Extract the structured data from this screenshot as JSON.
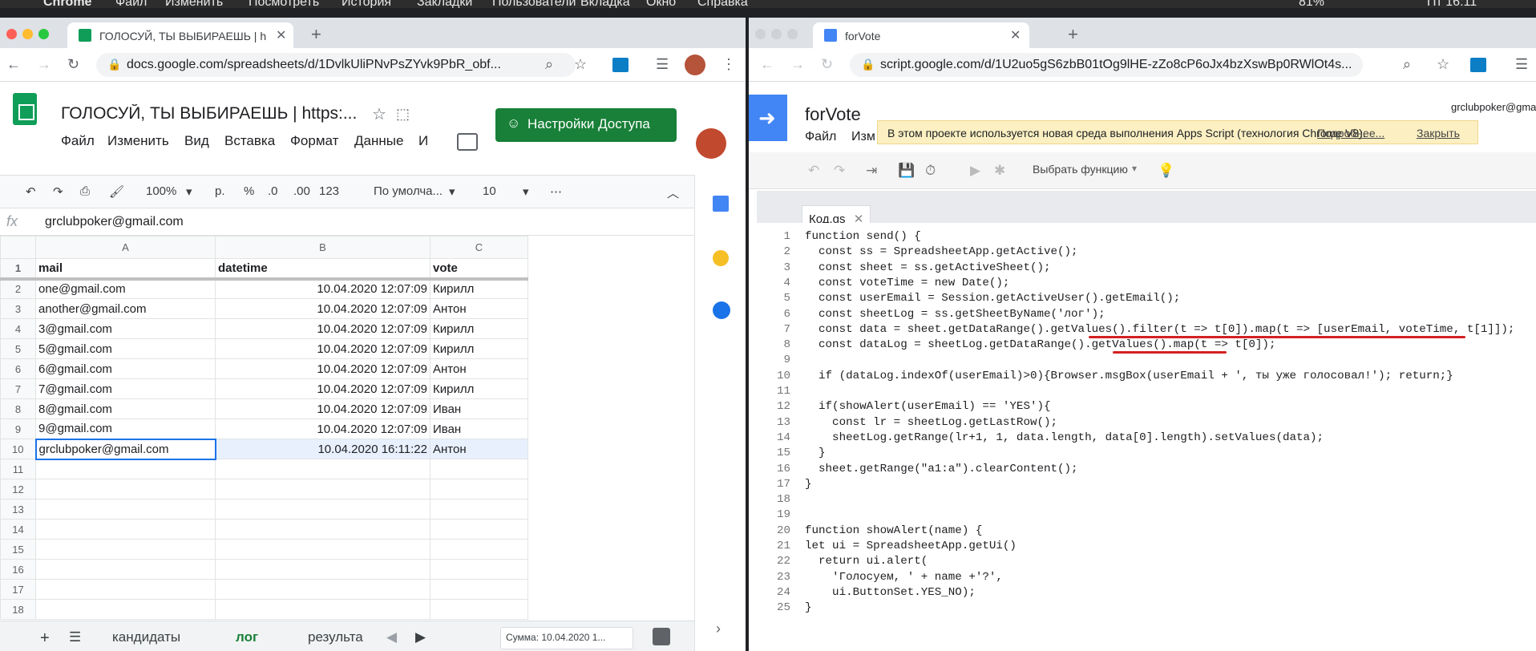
{
  "mac_menu": [
    "Chrome",
    "Файл",
    "Изменить",
    "Посмотреть",
    "История",
    "Закладки",
    "Пользователи",
    "Вкладка",
    "Окно",
    "Справка"
  ],
  "mac_status": {
    "battery": "81%",
    "time": "Пт 16:11"
  },
  "left_window": {
    "tab_title": "ГОЛОСУЙ, ТЫ ВЫБИРАЕШЬ | h",
    "url": "docs.google.com/spreadsheets/d/1DvlkUliPNvPsZYvk9PbR_obf...",
    "doc_title": "ГОЛОСУЙ, ТЫ ВЫБИРАЕШЬ | https:...",
    "menu": [
      "Файл",
      "Изменить",
      "Вид",
      "Вставка",
      "Формат",
      "Данные",
      "И"
    ],
    "share_label": "Настройки Доступа",
    "toolbar": {
      "zoom": "100%",
      "currency": "р.",
      "percent": "%",
      "dec_less": ".0",
      "dec_more": ".00",
      "format": "123",
      "font": "По умолча...",
      "size": "10"
    },
    "formula_value": "grclubpoker@gmail.com",
    "columns": [
      "A",
      "B",
      "C"
    ],
    "rows": [
      {
        "n": "1",
        "a": "mail",
        "b": "datetime",
        "c": "vote"
      },
      {
        "n": "2",
        "a": "one@gmail.com",
        "b": "10.04.2020 12:07:09",
        "c": "Кирилл"
      },
      {
        "n": "3",
        "a": "another@gmail.com",
        "b": "10.04.2020 12:07:09",
        "c": "Антон"
      },
      {
        "n": "4",
        "a": "3@gmail.com",
        "b": "10.04.2020 12:07:09",
        "c": "Кирилл"
      },
      {
        "n": "5",
        "a": "5@gmail.com",
        "b": "10.04.2020 12:07:09",
        "c": "Кирилл"
      },
      {
        "n": "6",
        "a": "6@gmail.com",
        "b": "10.04.2020 12:07:09",
        "c": "Антон"
      },
      {
        "n": "7",
        "a": "7@gmail.com",
        "b": "10.04.2020 12:07:09",
        "c": "Кирилл"
      },
      {
        "n": "8",
        "a": "8@gmail.com",
        "b": "10.04.2020 12:07:09",
        "c": "Иван"
      },
      {
        "n": "9",
        "a": "9@gmail.com",
        "b": "10.04.2020 12:07:09",
        "c": "Иван"
      },
      {
        "n": "10",
        "a": "grclubpoker@gmail.com",
        "b": "10.04.2020 16:11:22",
        "c": "Антон"
      },
      {
        "n": "11",
        "a": "",
        "b": "",
        "c": ""
      },
      {
        "n": "12",
        "a": "",
        "b": "",
        "c": ""
      },
      {
        "n": "13",
        "a": "",
        "b": "",
        "c": ""
      },
      {
        "n": "14",
        "a": "",
        "b": "",
        "c": ""
      },
      {
        "n": "15",
        "a": "",
        "b": "",
        "c": ""
      },
      {
        "n": "16",
        "a": "",
        "b": "",
        "c": ""
      },
      {
        "n": "17",
        "a": "",
        "b": "",
        "c": ""
      },
      {
        "n": "18",
        "a": "",
        "b": "",
        "c": ""
      }
    ],
    "sheet_tabs": [
      "кандидаты",
      "лог",
      "результа"
    ],
    "sum_label": "Сумма: 10.04.2020 1..."
  },
  "right_window": {
    "tab_title": "forVote",
    "url": "script.google.com/d/1U2uo5gS6zbB01tOg9lHE-zZo8cP6oJx4bzXswBp0RWlOt4s...",
    "project_title": "forVote",
    "account": "grclubpoker@gmail.com",
    "menu": [
      "Файл",
      "Изм"
    ],
    "notice": "В этом проекте используется новая среда выполнения Apps Script (технология Chrome V8).",
    "notice_link": "Подробнее...",
    "notice_close": "Закрыть",
    "select_function": "Выбрать функцию",
    "file_tab": "Код.gs",
    "code": [
      "function send() {",
      "  const ss = SpreadsheetApp.getActive();",
      "  const sheet = ss.getActiveSheet();",
      "  const voteTime = new Date();",
      "  const userEmail = Session.getActiveUser().getEmail();",
      "  const sheetLog = ss.getSheetByName('лог');",
      "  const data = sheet.getDataRange().getValues().filter(t => t[0]).map(t => [userEmail, voteTime, t[1]]);",
      "  const dataLog = sheetLog.getDataRange().getValues().map(t => t[0]);",
      "",
      "  if (dataLog.indexOf(userEmail)>0){Browser.msgBox(userEmail + ', ты уже голосовал!'); return;}",
      "",
      "  if(showAlert(userEmail) == 'YES'){",
      "    const lr = sheetLog.getLastRow();",
      "    sheetLog.getRange(lr+1, 1, data.length, data[0].length).setValues(data);",
      "  }",
      "  sheet.getRange(\"a1:a\").clearContent();",
      "}",
      "",
      "",
      "function showAlert(name) {",
      "let ui = SpreadsheetApp.getUi()",
      "  return ui.alert(",
      "    'Голосуем, ' + name +'?',",
      "    ui.ButtonSet.YES_NO);",
      "}"
    ]
  }
}
